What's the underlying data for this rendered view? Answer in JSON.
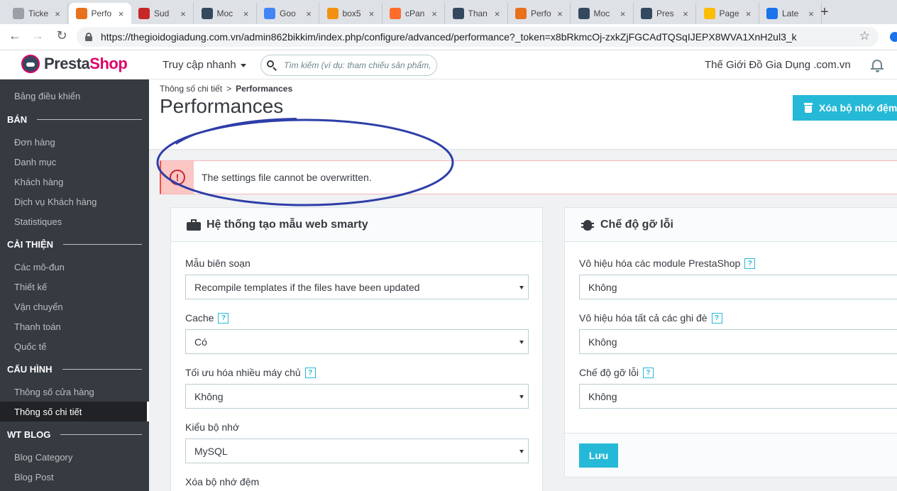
{
  "browser": {
    "tabs": [
      {
        "label": "Ticke",
        "favicon": "ticket-favicon",
        "color": "#9aa0a6"
      },
      {
        "label": "Perfo",
        "favicon": "hostdime-favicon",
        "color": "#e8711c"
      },
      {
        "label": "Sud",
        "favicon": "sud-favicon",
        "color": "#c62828"
      },
      {
        "label": "Moc",
        "favicon": "prestashop-favicon",
        "color": "#34495e"
      },
      {
        "label": "Goo",
        "favicon": "google-translate-favicon",
        "color": "#4285f4"
      },
      {
        "label": "box5",
        "favicon": "phpmyadmin-favicon",
        "color": "#f29111"
      },
      {
        "label": "cPan",
        "favicon": "cpanel-favicon",
        "color": "#ff6c2c"
      },
      {
        "label": "Than",
        "favicon": "prestashop-favicon",
        "color": "#34495e"
      },
      {
        "label": "Perfo",
        "favicon": "hostdime-favicon",
        "color": "#e8711c"
      },
      {
        "label": "Moc",
        "favicon": "prestashop-favicon",
        "color": "#34495e"
      },
      {
        "label": "Pres",
        "favicon": "prestashop-favicon",
        "color": "#34495e"
      },
      {
        "label": "Page",
        "favicon": "pagespeed-favicon",
        "color": "#fbbc05"
      },
      {
        "label": "Late",
        "favicon": "gt-favicon",
        "color": "#1a73e8"
      }
    ],
    "url": "https://thegioidogiadung.com.vn/admin862bikkim/index.php/configure/advanced/performance?_token=x8bRkmcOj-zxkZjFGCAdTQSqIJEPX8WVA1XnH2ul3_k"
  },
  "header": {
    "logo_presta": "Presta",
    "logo_shop": "Shop",
    "quick_access": "Truy cập nhanh",
    "search_placeholder": "Tìm kiếm (ví dụ: tham chiếu sản phẩm, tên khách hàng…)",
    "shop_name": "Thế Giới Đồ Gia Dụng .com.vn"
  },
  "sidebar": {
    "dashboard": "Bảng điều khiển",
    "sections": [
      {
        "title": "BÁN",
        "items": [
          "Đơn hàng",
          "Danh mục",
          "Khách hàng",
          "Dịch vụ Khách hàng",
          "Statistiques"
        ]
      },
      {
        "title": "CẢI THIỆN",
        "items": [
          "Các mô-đun",
          "Thiết kế",
          "Vận chuyển",
          "Thanh toán",
          "Quốc tế"
        ]
      },
      {
        "title": "CẤU HÌNH",
        "items": [
          "Thông số cửa hàng",
          "Thông số chi tiết"
        ]
      },
      {
        "title": "WT BLOG",
        "items": [
          "Blog Category",
          "Blog Post"
        ]
      }
    ],
    "active_item": "Thông số chi tiết"
  },
  "page": {
    "breadcrumb_parent": "Thông số chi tiết",
    "breadcrumb_sep": ">",
    "breadcrumb_current": "Performances",
    "title": "Performances",
    "clear_cache_label": "Xóa bộ nhớ đệm",
    "alert_icon": "!",
    "alert_text": "The settings file cannot be overwritten."
  },
  "smarty_panel": {
    "title": "Hệ thống tạo mẫu web smarty",
    "fields": [
      {
        "label": "Mẫu biên soạn",
        "help": false,
        "value": "Recompile templates if the files have been updated"
      },
      {
        "label": "Cache",
        "help": true,
        "value": "Có"
      },
      {
        "label": "Tối ưu hóa nhiều máy chủ",
        "help": true,
        "value": "Không"
      },
      {
        "label": "Kiểu bộ nhớ",
        "help": false,
        "value": "MySQL"
      },
      {
        "label": "Xóa bộ nhớ đệm",
        "help": false,
        "value": ""
      }
    ]
  },
  "debug_panel": {
    "title": "Chế độ gỡ lỗi",
    "fields": [
      {
        "label": "Vô hiệu hóa các module PrestaShop",
        "help": true,
        "value": "Không"
      },
      {
        "label": "Vô hiệu hóa tất cả các ghi đè",
        "help": true,
        "value": "Không"
      },
      {
        "label": "Chế độ gỡ lỗi",
        "help": true,
        "value": "Không"
      }
    ],
    "save_label": "Lưu"
  },
  "help_mark": "?",
  "colors": {
    "accent": "#25b9d7",
    "sidebar_bg": "#363a41",
    "error": "#c6283b",
    "annotation": "#2e3ea8"
  }
}
